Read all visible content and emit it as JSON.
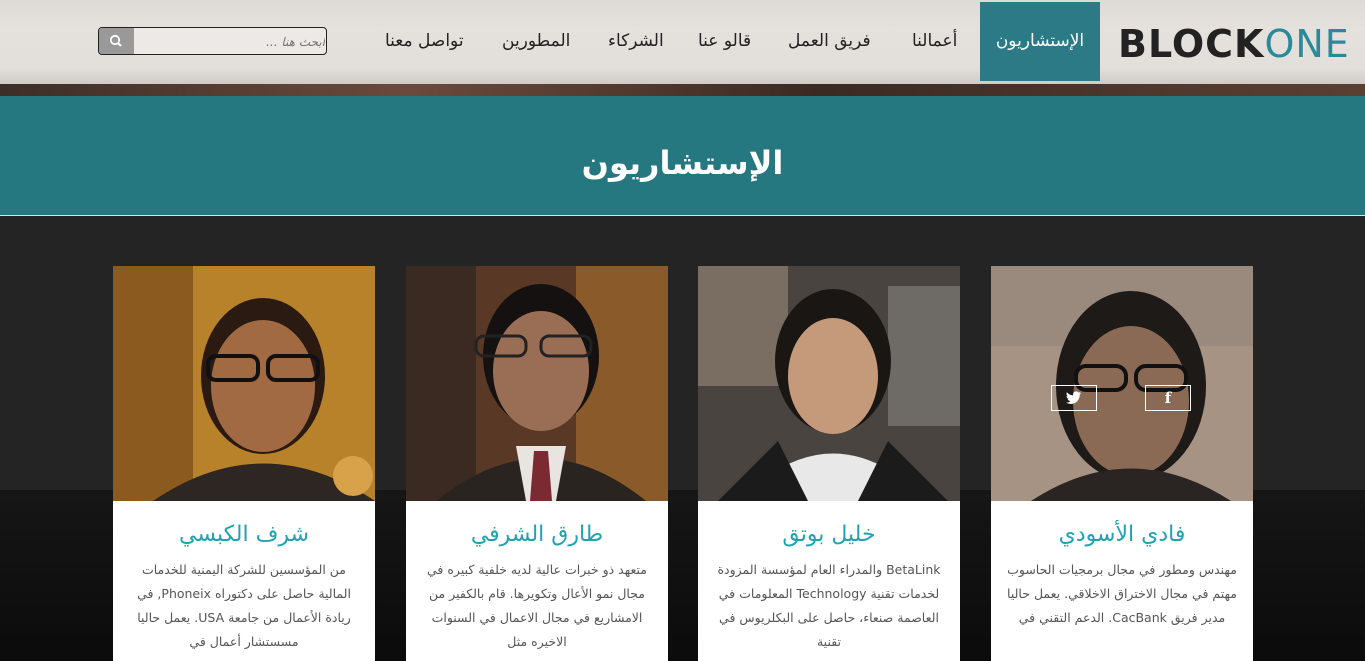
{
  "header": {
    "logo": {
      "part1": "BLOCK",
      "part2": "ONE"
    },
    "nav": [
      {
        "label": "الإستشاريون",
        "active": true
      },
      {
        "label": "أعمالنا",
        "active": false
      },
      {
        "label": "فريق العمل",
        "active": false
      },
      {
        "label": "قالو عنا",
        "active": false
      },
      {
        "label": "الشركاء",
        "active": false
      },
      {
        "label": "المطورين",
        "active": false
      },
      {
        "label": "تواصل معنا",
        "active": false
      }
    ],
    "search": {
      "placeholder": "ابحث هنا ..."
    }
  },
  "banner": {
    "title": "الإستشاريون"
  },
  "consultants": [
    {
      "name": "فادي الأسودي",
      "bio": "مهندس ومطور في مجال برمجيات الحاسوب مهتم في مجال الاختراق الاخلاقي. يعمل حاليا مدير فريق CacBank. الدعم التقني في",
      "social": {
        "twitter_icon": "twitter-icon",
        "facebook_icon": "facebook-icon"
      }
    },
    {
      "name": "خليل بوتق",
      "bio": "BetaLink والمدراء العام لمؤسسة المزودة لخدمات تقنية Technology المعلومات في العاصمة صنعاء، حاصل على البكلريوس في تقنية"
    },
    {
      "name": "طارق الشرفي",
      "bio": "متعهد ذو خبرات عالية لديه خلفية كبيره في مجال نمو الأعال وتكويرها. قام بالكفير من الامشاريع في مجال الاعمال في السنوات الاخيره مثل"
    },
    {
      "name": "شرف الكبسي",
      "bio": "من المؤسسين للشركة اليمنية للخدمات المالية حاصل على دكتوراه Phoneix, في ريادة الأعمال من جامعة USA. يعمل حاليا مسستشار أعمال في"
    }
  ],
  "colors": {
    "accent": "#267880",
    "name": "#1fa3b2",
    "active_nav": "#2b7a85"
  }
}
